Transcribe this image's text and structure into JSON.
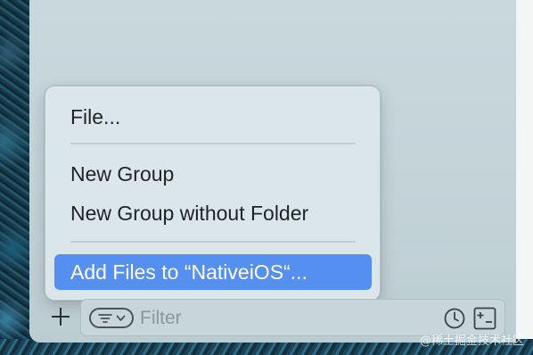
{
  "menu": {
    "items": [
      {
        "label": "File..."
      },
      {
        "label": "New Group"
      },
      {
        "label": "New Group without Folder"
      },
      {
        "label": "Add Files to “NativeiOS“..."
      }
    ],
    "selected_index": 3
  },
  "filter_bar": {
    "add_label": "+",
    "placeholder": "Filter",
    "icons": [
      "plus-icon",
      "filter-options-icon",
      "chevron-down-icon",
      "clock-icon",
      "plus-minus-icon"
    ]
  },
  "watermark": "@稀土掘金技术社区",
  "colors": {
    "selection": "#5590f1",
    "menu_background": "#dae6e9",
    "panel_background": "#c9d8dd"
  }
}
